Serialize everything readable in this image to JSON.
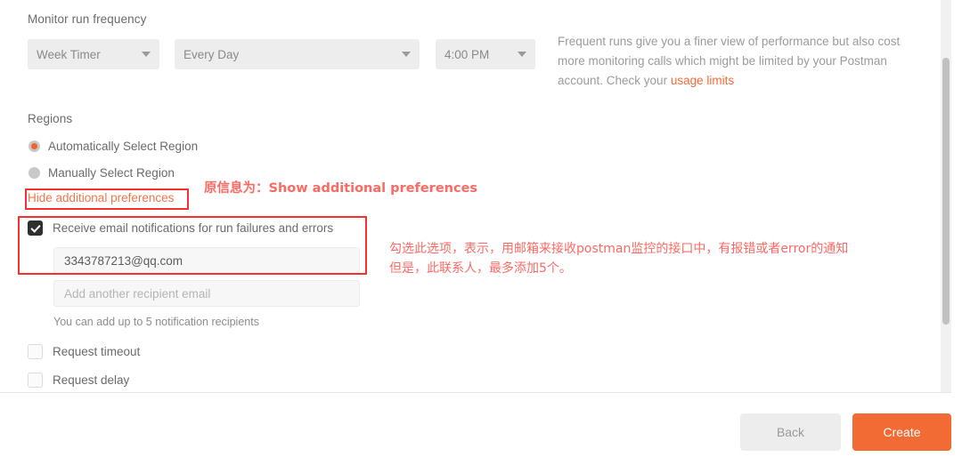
{
  "form": {
    "frequency_label": "Monitor run frequency",
    "selects": [
      {
        "name": "timer-type",
        "value": "Week Timer"
      },
      {
        "name": "day",
        "value": "Every Day"
      },
      {
        "name": "time",
        "value": "4:00 PM"
      }
    ],
    "info": {
      "text": "Frequent runs give you a finer view of performance but also cost more monitoring calls which might be limited by your Postman account. Check your ",
      "link": "usage limits"
    },
    "regions_label": "Regions",
    "region_options": [
      {
        "label": "Automatically Select Region",
        "selected": true
      },
      {
        "label": "Manually Select Region",
        "selected": false
      }
    ],
    "preferences_toggle": "Hide additional preferences",
    "email_notifications": {
      "label": "Receive email notifications for run failures and errors",
      "checked": true,
      "recipient_value": "3343787213@qq.com",
      "add_recipient_placeholder": "Add another recipient email",
      "helper": "You can add up to 5 notification recipients"
    },
    "extra_options": [
      {
        "label": "Request timeout",
        "checked": false
      },
      {
        "label": "Request delay",
        "checked": false
      }
    ]
  },
  "footer": {
    "back_label": "Back",
    "create_label": "Create"
  },
  "annotations": {
    "original_message": "原信息为：Show additional preferences",
    "email_note_line1": "勾选此选项，表示，用邮箱来接收postman监控的接口中，有报错或者error的通知",
    "email_note_line2": "但是，此联系人，最多添加5个。"
  },
  "colors": {
    "accent": "#f26b34",
    "link": "#f26b3a",
    "annotation_box": "#f8302f",
    "annotation_text": "#fb6a64"
  }
}
